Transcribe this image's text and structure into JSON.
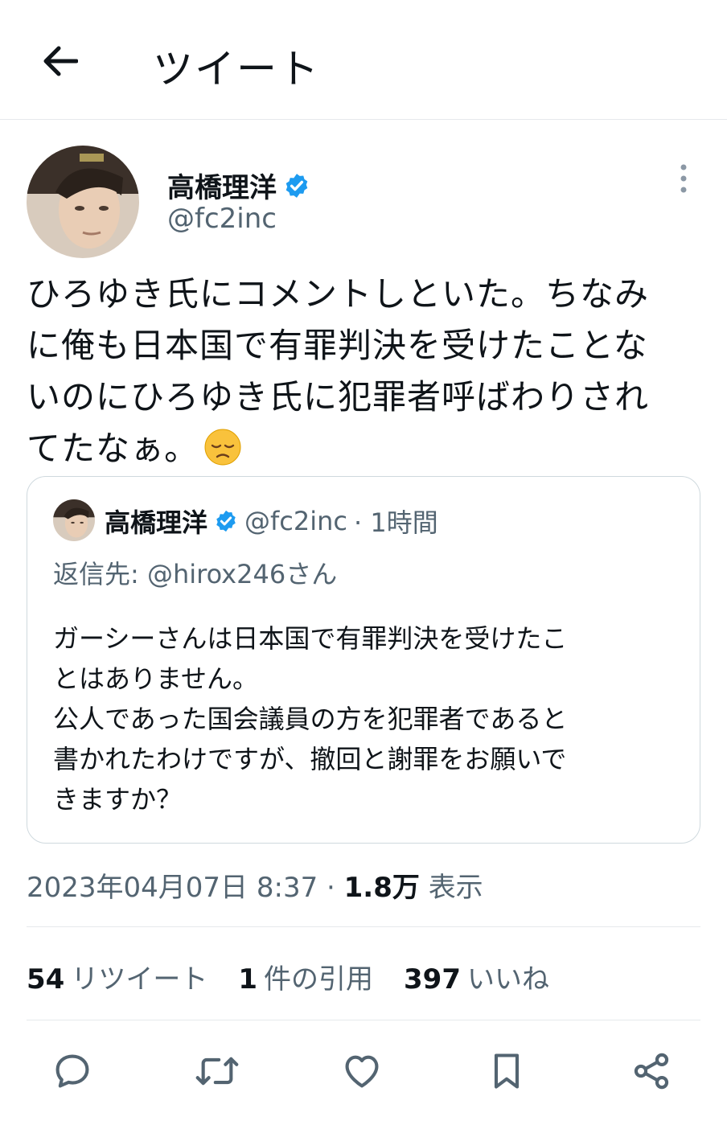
{
  "header": {
    "title": "ツイート",
    "back_icon": "arrow-left-icon"
  },
  "tweet": {
    "author_name": "高橋理洋",
    "author_handle": "@fc2inc",
    "text": "ひろゆき氏にコメントしといた。ちなみ\nに俺も日本国で有罪判決を受けたことな\nいのにひろゆき氏に犯罪者呼ばわりされ\nてたなぁ。",
    "emoji": "disappointed-face-emoji"
  },
  "quote": {
    "author_name": "高橋理洋",
    "author_handle": "@fc2inc",
    "time": "· 1時間",
    "reply_to": "返信先: @hirox246さん",
    "text": "ガーシーさんは日本国で有罪判決を受けたこ\nとはありません。\n公人であった国会議員の方を犯罪者であると\n書かれたわけですが、撤回と謝罪をお願いで\nきますか？"
  },
  "meta": {
    "datetime": "2023年04月07日 8:37 ·",
    "views_count": "1.8万",
    "views_label": "表示"
  },
  "stats": {
    "retweets_count": "54",
    "retweets_label": "リツイート",
    "quotes_count": "1",
    "quotes_label": "件の引用",
    "likes_count": "397",
    "likes_label": "いいね"
  },
  "colors": {
    "verified": "#1d9bf0",
    "secondary_text": "#536471",
    "border": "#cfd9de"
  }
}
